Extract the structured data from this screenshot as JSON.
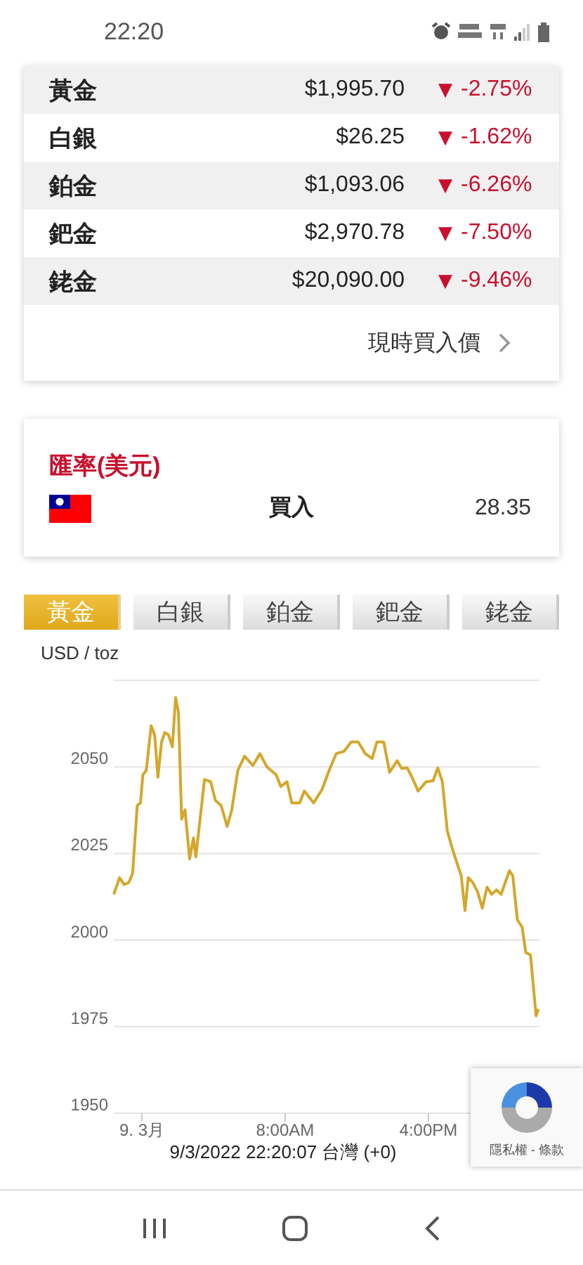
{
  "status_bar": {
    "time": "22:20"
  },
  "prices": {
    "rows": [
      {
        "metal": "黃金",
        "price": "$1,995.70",
        "arrow": "▼",
        "change": "-2.75%"
      },
      {
        "metal": "白銀",
        "price": "$26.25",
        "arrow": "▼",
        "change": "-1.62%"
      },
      {
        "metal": "鉑金",
        "price": "$1,093.06",
        "arrow": "▼",
        "change": "-6.26%"
      },
      {
        "metal": "鈀金",
        "price": "$2,970.78",
        "arrow": "▼",
        "change": "-7.50%"
      },
      {
        "metal": "銠金",
        "price": "$20,090.00",
        "arrow": "▼",
        "change": "-9.46%"
      }
    ],
    "link": "現時買入價"
  },
  "exchange": {
    "title": "匯率(美元)",
    "label": "買入",
    "rate": "28.35"
  },
  "tabs": [
    {
      "label": "黃金",
      "selected": true
    },
    {
      "label": "白銀",
      "selected": false
    },
    {
      "label": "鉑金",
      "selected": false
    },
    {
      "label": "鈀金",
      "selected": false
    },
    {
      "label": "銠金",
      "selected": false
    }
  ],
  "chart": {
    "unit": "USD / toz",
    "chart_data": {
      "type": "line",
      "grid": true,
      "ylim": [
        1950,
        2075
      ],
      "xlim": [
        -1.57,
        22.2
      ],
      "yticks": [
        1950,
        1975,
        2000,
        2025,
        2050
      ],
      "xticks": [
        {
          "value": 0,
          "label": "9. 3月"
        },
        {
          "value": 8,
          "label": "8:00AM"
        },
        {
          "value": 16,
          "label": "4:00PM"
        }
      ],
      "x": [
        -1.57,
        -1.25,
        -0.99,
        -0.73,
        -0.52,
        -0.26,
        -0.08,
        0.05,
        0.24,
        0.52,
        0.71,
        0.89,
        1.1,
        1.28,
        1.49,
        1.7,
        1.88,
        2.04,
        2.22,
        2.41,
        2.67,
        2.88,
        3.01,
        3.5,
        3.84,
        4.1,
        4.42,
        4.76,
        5.02,
        5.36,
        5.73,
        6.2,
        6.59,
        6.98,
        7.5,
        7.76,
        8.1,
        8.37,
        8.81,
        9.07,
        9.59,
        10.07,
        10.46,
        10.85,
        11.29,
        11.69,
        12.08,
        12.47,
        12.86,
        13.12,
        13.51,
        13.83,
        14.25,
        14.51,
        14.82,
        15.14,
        15.42,
        15.87,
        16.26,
        16.52,
        16.78,
        17.05,
        17.39,
        17.83,
        18.04,
        18.22,
        18.48,
        18.75,
        19.01,
        19.27,
        19.53,
        19.8,
        20.06,
        20.52,
        20.71,
        20.97,
        21.23,
        21.44,
        21.7,
        22.01,
        22.14
      ],
      "series": [
        {
          "color": "#d4a72c",
          "values": [
            2013.2,
            2018,
            2016,
            2016.6,
            2019.3,
            2038.9,
            2039.6,
            2047.7,
            2049,
            2061.9,
            2059.2,
            2047,
            2057.2,
            2059.9,
            2059.2,
            2055.8,
            2070,
            2065.9,
            2034.9,
            2037.6,
            2023.4,
            2029.5,
            2024,
            2046.4,
            2045.7,
            2040.3,
            2038.9,
            2032.8,
            2037.6,
            2049,
            2053.1,
            2050.4,
            2053.8,
            2050,
            2047.7,
            2044.3,
            2045.7,
            2039.6,
            2039.6,
            2043,
            2039.6,
            2043.6,
            2049,
            2053.8,
            2054.5,
            2057.2,
            2057.2,
            2053.8,
            2052.4,
            2057.2,
            2057.2,
            2048.4,
            2051.8,
            2049.5,
            2049.7,
            2046.4,
            2043,
            2045.7,
            2046,
            2049.7,
            2045.7,
            2031.5,
            2025.4,
            2018.6,
            2008.5,
            2018,
            2016.6,
            2013.9,
            2009.2,
            2015.3,
            2013.2,
            2014.5,
            2013.2,
            2020,
            2018.6,
            2005.8,
            2003.8,
            1996.4,
            1995.7,
            1978.1,
            1980.1
          ]
        }
      ]
    },
    "timestamp": "9/3/2022 22:20:07 台灣 (+0)"
  },
  "recaptcha": {
    "links": "隱私權 - 條款"
  }
}
